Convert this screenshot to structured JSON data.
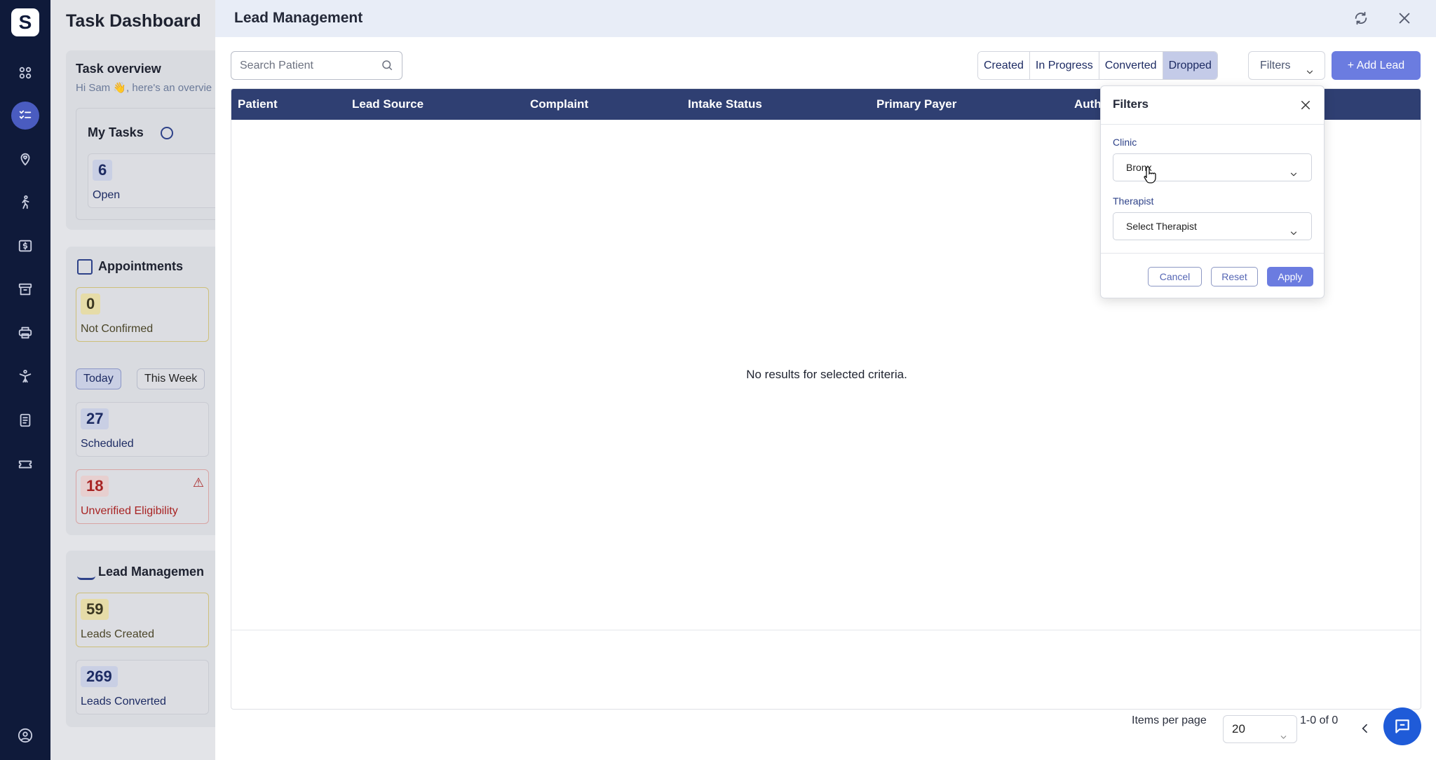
{
  "app": {
    "logo_letter": "S"
  },
  "nav_icons": [
    "grid-icon",
    "tasks-icon",
    "location-heart-icon",
    "walking-person-icon",
    "billing-icon",
    "archive-icon",
    "printer-icon",
    "exercise-icon",
    "document-icon",
    "ticket-icon",
    "user-profile-icon"
  ],
  "dashboard": {
    "title": "Task Dashboard",
    "task_overview": {
      "heading": "Task overview",
      "greeting": "Hi Sam 👋, here's an overvie"
    },
    "my_tasks": {
      "heading": "My Tasks",
      "open_count": "6",
      "open_label": "Open"
    },
    "appointments": {
      "heading": "Appointments",
      "not_confirmed_count": "0",
      "not_confirmed_label": "Not Confirmed",
      "toggle_today": "Today",
      "toggle_week": "This Week",
      "scheduled_count": "27",
      "scheduled_label": "Scheduled",
      "unverified_count": "18",
      "unverified_label": "Unverified Eligibility"
    },
    "lead_management": {
      "heading": "Lead Managemen",
      "created_count": "59",
      "created_label": "Leads Created",
      "converted_count": "269",
      "converted_label": "Leads Converted"
    }
  },
  "modal": {
    "title": "Lead Management",
    "search": {
      "placeholder": "Search Patient",
      "value": ""
    },
    "status_tabs": [
      {
        "label": "Created",
        "selected": false
      },
      {
        "label": "In Progress",
        "selected": false
      },
      {
        "label": "Converted",
        "selected": false
      },
      {
        "label": "Dropped",
        "selected": true
      }
    ],
    "filters_button": "Filters",
    "add_lead_button": "+ Add Lead",
    "columns": [
      "Patient",
      "Lead Source",
      "Complaint",
      "Intake Status",
      "Primary Payer",
      "Auth"
    ],
    "empty_message": "No results for selected criteria.",
    "pagination": {
      "items_per_page_label": "Items per page",
      "items_per_page_value": "20",
      "range": "1-0 of 0"
    }
  },
  "filters_popover": {
    "title": "Filters",
    "clinic_label": "Clinic",
    "clinic_value": "Bronx",
    "therapist_label": "Therapist",
    "therapist_value": "Select Therapist",
    "cancel": "Cancel",
    "reset": "Reset",
    "apply": "Apply"
  },
  "colors": {
    "rail": "#0f1a3a",
    "header_bar": "#2f3f72",
    "accent": "#6b7ce0",
    "selected_tab": "#c4cbe8",
    "danger": "#a82323",
    "fab": "#1f5bd8"
  }
}
